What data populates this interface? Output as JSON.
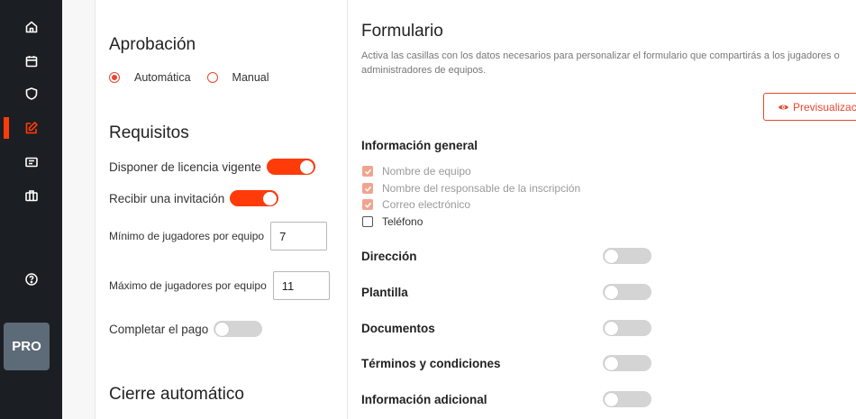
{
  "sidebar": {
    "items": [
      {
        "name": "home-icon",
        "active": false
      },
      {
        "name": "calendar-icon",
        "active": false
      },
      {
        "name": "shield-icon",
        "active": false
      },
      {
        "name": "edit-icon",
        "active": true
      },
      {
        "name": "id-card-icon",
        "active": false
      },
      {
        "name": "briefcase-icon",
        "active": false
      },
      {
        "name": "help-icon",
        "active": false
      }
    ],
    "pro_label": "PRO",
    "accent": "#ff3b0a"
  },
  "aprobacion": {
    "title": "Aprobación",
    "options": [
      {
        "label": "Automática",
        "selected": true
      },
      {
        "label": "Manual",
        "selected": false
      }
    ]
  },
  "requisitos": {
    "title": "Requisitos",
    "licencia_label": "Disponer de licencia vigente",
    "licencia_on": true,
    "invitacion_label": "Recibir una invitación",
    "invitacion_on": true,
    "min_label": "Mínimo de jugadores por equipo",
    "min_value": "7",
    "max_label": "Máximo de jugadores por equipo",
    "max_value": "11",
    "pago_label": "Completar el pago",
    "pago_on": false
  },
  "cierre": {
    "title": "Cierre automático"
  },
  "formulario": {
    "title": "Formulario",
    "description": "Activa las casillas con los datos necesarios para personalizar el formulario que compartirás a los jugadores o administradores de equipos.",
    "preview_label": "Previsualizaci",
    "general_title": "Información general",
    "checks": [
      {
        "label": "Nombre de equipo",
        "checked": true
      },
      {
        "label": "Nombre del responsable de la inscripción",
        "checked": true
      },
      {
        "label": "Correo electrónico",
        "checked": true
      },
      {
        "label": "Teléfono",
        "checked": false
      }
    ],
    "options": [
      {
        "label": "Dirección",
        "on": false
      },
      {
        "label": "Plantilla",
        "on": false
      },
      {
        "label": "Documentos",
        "on": false
      },
      {
        "label": "Términos y condiciones",
        "on": false
      },
      {
        "label": "Información adicional",
        "on": false
      }
    ]
  }
}
